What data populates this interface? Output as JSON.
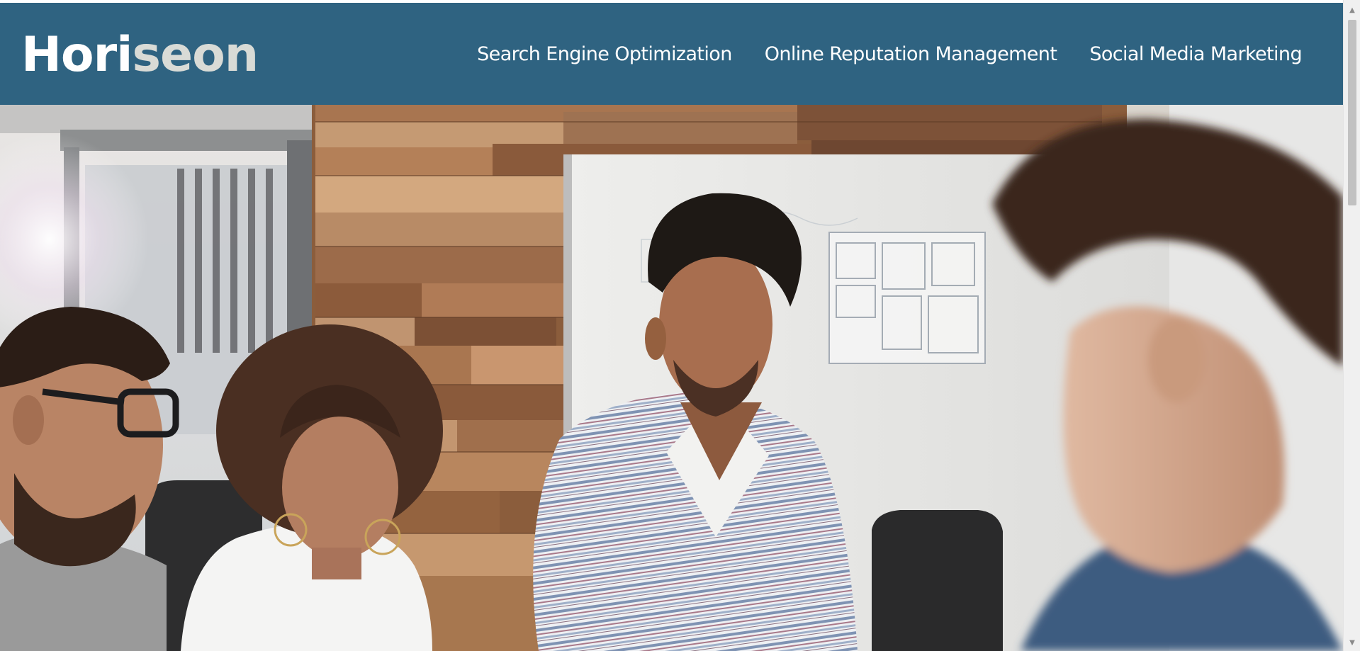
{
  "header": {
    "logo": {
      "part1": "Hori",
      "part2": "seon"
    },
    "nav": [
      {
        "label": "Search Engine Optimization"
      },
      {
        "label": "Online Reputation Management"
      },
      {
        "label": "Social Media Marketing"
      }
    ]
  },
  "hero": {
    "image": "team-meeting-photo"
  },
  "scrollbar": {
    "up_icon": "▲",
    "down_icon": "▼",
    "position_fraction": 0.0
  },
  "colors": {
    "header_bg": "#2f6381",
    "logo_text": "#ffffff",
    "logo_accent": "#d9dbd6",
    "nav_text": "#ffffff"
  }
}
